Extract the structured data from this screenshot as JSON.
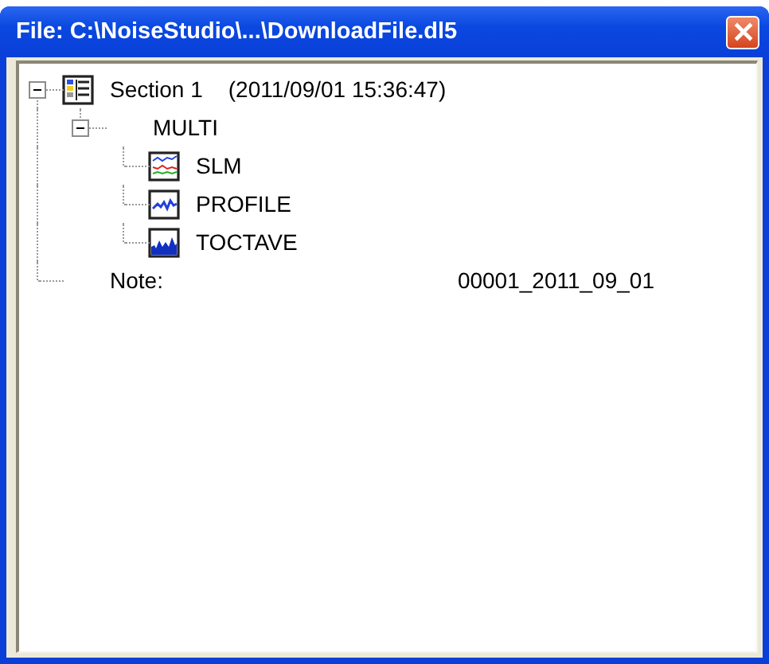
{
  "window": {
    "title": "File: C:\\NoiseStudio\\...\\DownloadFile.dl5"
  },
  "tree": [
    {
      "label": "Section 1",
      "detail": "(2011/09/01 15:36:47)",
      "kind": "section",
      "expanded": true,
      "children": [
        {
          "label": "MULTI",
          "expanded": true,
          "children": [
            {
              "label": "SLM",
              "kind": "slm"
            },
            {
              "label": "PROFILE",
              "kind": "profile"
            },
            {
              "label": "TOCTAVE",
              "kind": "octave"
            }
          ]
        }
      ]
    },
    {
      "label": "Note:",
      "value": "00001_2011_09_01",
      "kind": "note"
    }
  ]
}
